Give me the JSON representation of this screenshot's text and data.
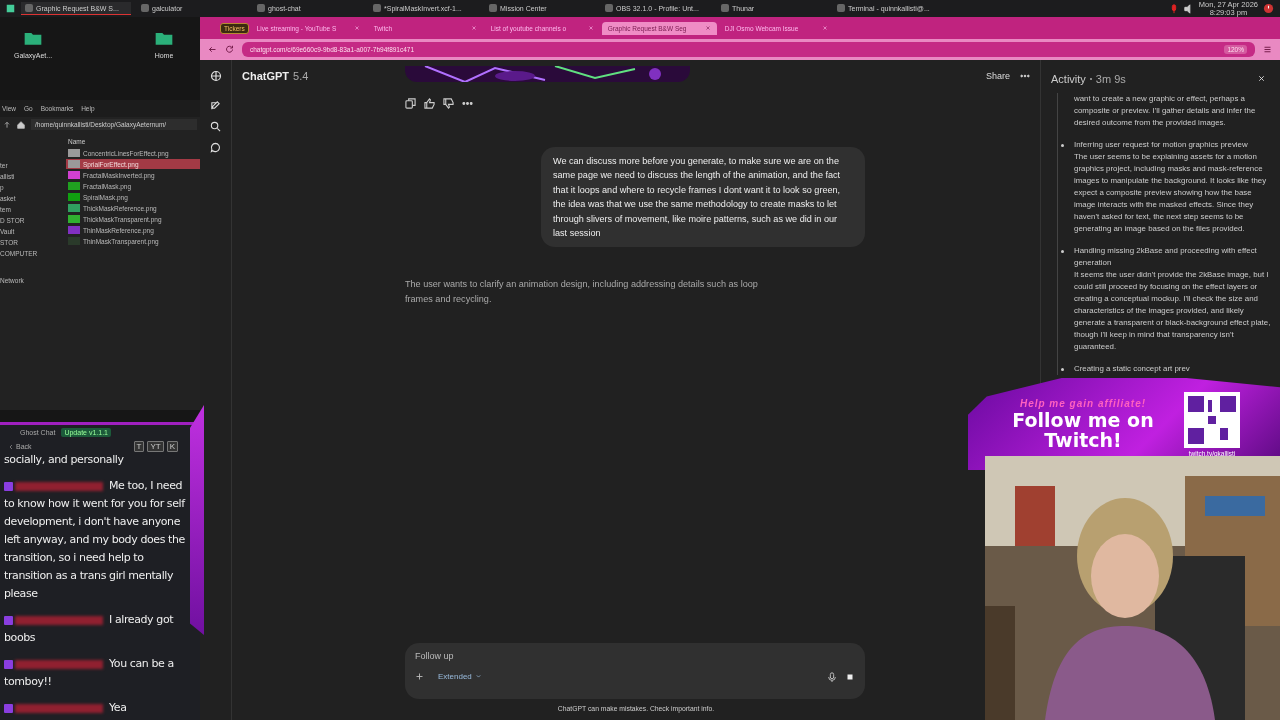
{
  "taskbar": {
    "apps": [
      {
        "label": "Graphic Request B&W S...",
        "selected": true
      },
      {
        "label": "galculator",
        "selected": false
      },
      {
        "label": "ghost-chat",
        "selected": false
      },
      {
        "label": "*SpiralMaskInvert.xcf-1...",
        "selected": false
      },
      {
        "label": "Mission Center",
        "selected": false
      },
      {
        "label": "OBS 32.1.0 - Profile: Unt...",
        "selected": false
      },
      {
        "label": "Thunar",
        "selected": false
      },
      {
        "label": "Terminal - quinnkallisti@...",
        "selected": false
      }
    ],
    "date": "Mon, 27 Apr 2026",
    "time": "8:29:03 pm"
  },
  "desktop_icons": [
    {
      "label": "GalaxyAet..."
    },
    {
      "label": "Home"
    }
  ],
  "file_manager": {
    "menu": [
      "View",
      "Go",
      "Bookmarks",
      "Help"
    ],
    "path": "/home/quinnkallisti/Desktop/GalaxyAeternum/",
    "sidebar": [
      "ter",
      "allisti",
      "p",
      "asket",
      "tem",
      "D STOR",
      "Vault",
      "STOR",
      "COMPUTER",
      "Network"
    ],
    "column": "Name",
    "files": [
      {
        "name": "ConcentricLinesForEffect.png",
        "selected": false,
        "color": "#9a9a9a"
      },
      {
        "name": "SprialForEffect.png",
        "selected": true,
        "color": "#9a9a9a"
      },
      {
        "name": "FractalMaskInverted.png",
        "selected": false,
        "color": "#d040d0"
      },
      {
        "name": "FractalMask.png",
        "selected": false,
        "color": "#20a020"
      },
      {
        "name": "SpiralMask.png",
        "selected": false,
        "color": "#10a010"
      },
      {
        "name": "ThickMaskReference.png",
        "selected": false,
        "color": "#30a060"
      },
      {
        "name": "ThickMaskTransparent.png",
        "selected": false,
        "color": "#30b030"
      },
      {
        "name": "ThinMaskReference.png",
        "selected": false,
        "color": "#8030c0"
      },
      {
        "name": "ThinMaskTransparent.png",
        "selected": false,
        "color": "#2a3a2a"
      }
    ]
  },
  "chat_overlay": {
    "title": "Ghost Chat",
    "badge": "Update v1.1.1",
    "back": "Back",
    "buttons": [
      "T",
      "YT",
      "K"
    ],
    "messages": [
      {
        "text": "socially, and personally",
        "has_author": false
      },
      {
        "text": "Me too, I need to know how it went for you for self development, i don't have anyone left anyway, and my body does the transition, so i need help to transition as a trans girl mentally please",
        "has_author": true
      },
      {
        "text": "I already got boobs",
        "has_author": true
      },
      {
        "text": "You can be a tomboy!!",
        "has_author": true
      },
      {
        "text": "Yea",
        "has_author": true
      }
    ]
  },
  "browser": {
    "tabs": [
      {
        "label": "Tickers",
        "kind": "pinned",
        "selected": false
      },
      {
        "label": "Live streaming - YouTube S",
        "kind": "tab",
        "selected": false
      },
      {
        "label": "Twitch",
        "kind": "tab",
        "selected": false
      },
      {
        "label": "List of youtube channels o",
        "kind": "tab",
        "selected": false
      },
      {
        "label": "Graphic Request B&W Seg",
        "kind": "tab",
        "selected": true
      },
      {
        "label": "DJI Osmo Webcam Issue",
        "kind": "tab",
        "selected": false
      }
    ],
    "url": "chatgpt.com/c/69e660c9-9bd8-83a1-a007-7b94f891c471",
    "zoom": "120%"
  },
  "chat": {
    "title": "ChatGPT",
    "version": "5.4",
    "share": "Share",
    "user_message": "We can discuss more before you generate, to make sure we are on the same page we need to discuss the length of the animation, and the fact that it loops and where to recycle frames I dont want it to look so green, the idea was that we use the same methodology to create masks to let through slivers of movement, like moire patterns, such as we did in our last session",
    "assistant_note": "The user wants to clarify an animation design, including addressing details such as loop frames and recycling.",
    "input": {
      "placeholder": "Follow up"
    },
    "mode": "Extended",
    "disclaimer": "ChatGPT can make mistakes. Check important info."
  },
  "activity": {
    "title": "Activity",
    "duration": "3m 9s",
    "intro": "want to create a new graphic or effect, perhaps a composite or preview. I'll gather details and infer the desired outcome from the provided images.",
    "items": [
      {
        "heading": "Inferring user request for motion graphics preview",
        "body": "The user seems to be explaining assets for a motion graphics project, including masks and mask-reference images to manipulate the background. It looks like they expect a composite preview showing how the base image interacts with the masked effects. Since they haven't asked for text, the next step seems to be generating an image based on the files provided."
      },
      {
        "heading": "Handling missing 2kBase and proceeding with effect generation",
        "body": "It seems the user didn't provide the 2kBase image, but I could still proceed by focusing on the effect layers or creating a conceptual mockup. I'll check the size and characteristics of the images provided, and likely generate a transparent or black-background effect plate, though I'll keep in mind that transparency isn't guaranteed."
      },
      {
        "heading": "Creating a static concept art prev"
      }
    ]
  },
  "stream_overlay": {
    "tagline": "Help me gain affiliate!",
    "headline": "Follow me on Twitch!",
    "handle": "twitch.tv/qkallisti"
  }
}
